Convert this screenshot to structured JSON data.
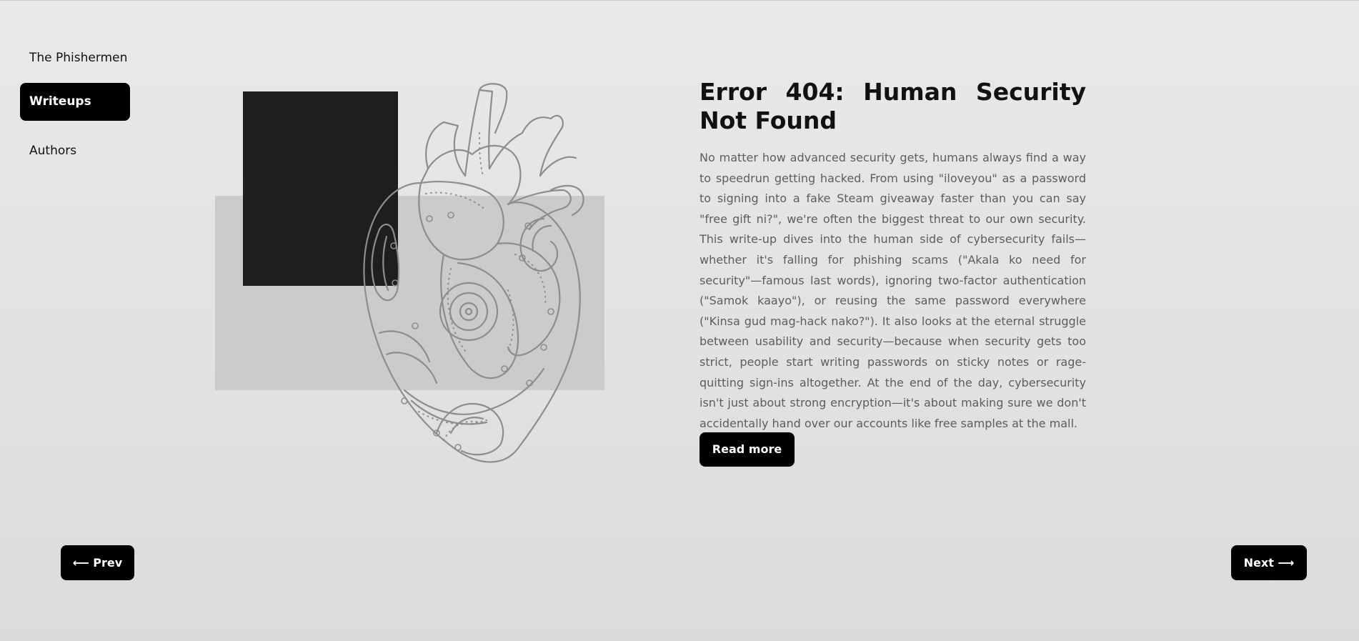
{
  "nav": {
    "items": [
      {
        "label": "The Phishermen"
      },
      {
        "label": "Writeups"
      },
      {
        "label": "Authors"
      }
    ]
  },
  "article": {
    "title": "Error 404: Human Security Not Found",
    "body": "No matter how advanced security gets, humans always find a way to speedrun getting hacked. From using \"iloveyou\" as a password to signing into a fake Steam giveaway faster than you can say \"free gift ni?\", we're often the biggest threat to our own security. This write-up dives into the human side of cybersecurity fails—whether it's falling for phishing scams (\"Akala ko need for security\"—famous last words), ignoring two-factor authentication (\"Samok kaayo\"), or reusing the same password everywhere (\"Kinsa gud mag-hack nako?\"). It also looks at the eternal struggle between usability and security—because when security gets too strict, people start writing passwords on sticky notes or rage-quitting sign-ins altogether. At the end of the day, cybersecurity isn't just about strong encryption—it's about making sure we don't accidentally hand over our accounts like free samples at the mall.",
    "read_more_label": "Read more"
  },
  "pager": {
    "prev_label": "⟵ Prev",
    "next_label": "Next ⟶"
  },
  "illustration": {
    "icon": "mechanical-heart-illustration",
    "colors": {
      "accent_block": "#1e1e1c",
      "backdrop": "#cbcbcb",
      "line": "#8d8d8d"
    }
  }
}
